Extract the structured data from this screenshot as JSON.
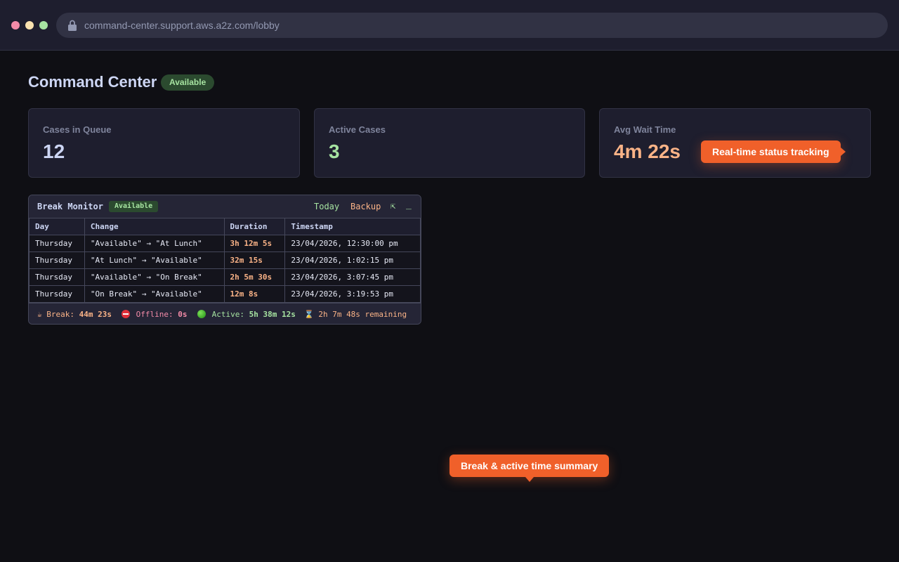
{
  "browser": {
    "url": "command-center.support.aws.a2z.com/lobby"
  },
  "header": {
    "title": "Command Center",
    "status": "Available"
  },
  "stats": [
    {
      "label": "Cases in Queue",
      "value": "12"
    },
    {
      "label": "Active Cases",
      "value": "3"
    },
    {
      "label": "Avg Wait Time",
      "value": "4m 22s"
    }
  ],
  "callouts": {
    "realtime": "Real-time status tracking",
    "summary": "Break & active time summary"
  },
  "monitor": {
    "title": "Break Monitor",
    "status": "Available",
    "today_label": "Today",
    "backup_label": "Backup",
    "expand_glyph": "⇱",
    "minimize_glyph": "_",
    "columns": [
      "Day",
      "Change",
      "Duration",
      "Timestamp"
    ],
    "rows": [
      {
        "day": "Thursday",
        "change": "\"Available\" → \"At Lunch\"",
        "duration": "3h 12m 5s",
        "timestamp": "23/04/2026, 12:30:00 pm"
      },
      {
        "day": "Thursday",
        "change": "\"At Lunch\" → \"Available\"",
        "duration": "32m 15s",
        "timestamp": "23/04/2026, 1:02:15 pm"
      },
      {
        "day": "Thursday",
        "change": "\"Available\" → \"On Break\"",
        "duration": "2h 5m 30s",
        "timestamp": "23/04/2026, 3:07:45 pm"
      },
      {
        "day": "Thursday",
        "change": "\"On Break\" → \"Available\"",
        "duration": "12m 8s",
        "timestamp": "23/04/2026, 3:19:53 pm"
      }
    ],
    "footer": {
      "break_icon": "☕",
      "break_label": "Break:",
      "break_value": "44m 23s",
      "offline_label": "Offline:",
      "offline_value": "0s",
      "active_label": "Active:",
      "active_value": "5h 38m 12s",
      "remaining_icon": "⌛",
      "remaining_text": "2h 7m 48s remaining"
    }
  },
  "colors": {
    "accent": "#f0602a",
    "green": "#a6e3a1",
    "peach": "#fab387",
    "background": "#0f0f14"
  }
}
